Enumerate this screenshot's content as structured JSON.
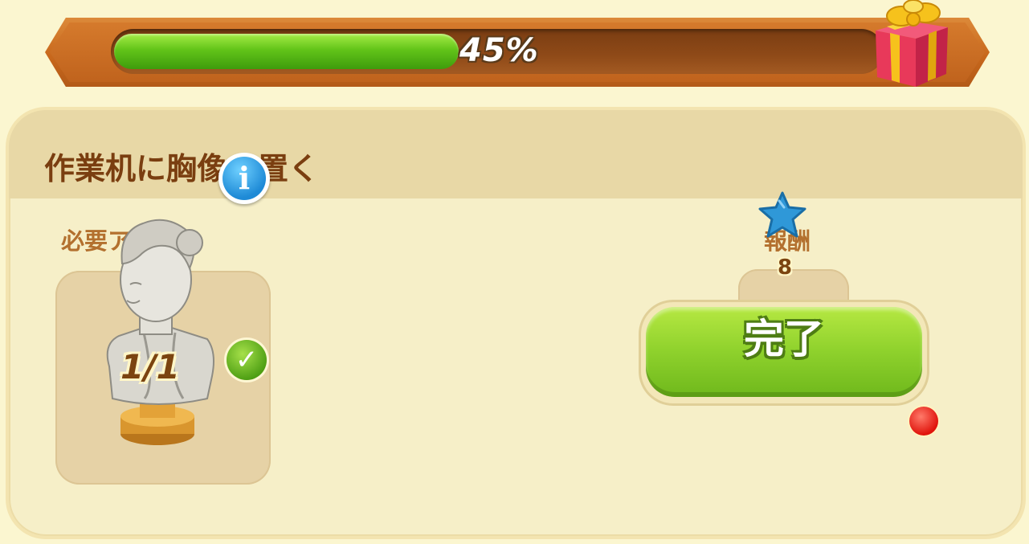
{
  "progress": {
    "value_percent": 45,
    "label": "45%",
    "fill_color": "#5cc21a"
  },
  "reward_chest": {
    "icon": "gift-box-icon"
  },
  "task": {
    "title": "作業机に胸像を置く",
    "required_label": "必要アイテム",
    "required_item": {
      "icon": "marble-bust-icon",
      "count": "1/1",
      "info_icon": "info-icon",
      "status_icon": "checkmark-icon"
    },
    "reward_label": "報酬",
    "reward": {
      "icon": "blue-star-icon",
      "qty": "8"
    },
    "complete_button": {
      "label": "完了",
      "badge": "notification-dot"
    }
  }
}
